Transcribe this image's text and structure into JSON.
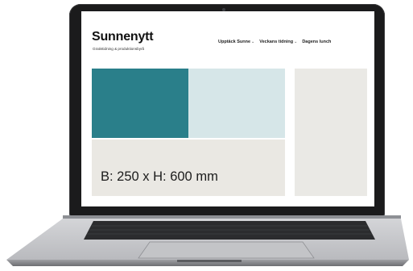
{
  "site": {
    "logo": "Sunnenytt",
    "tagline": "Gratistidning & produktionsbyrå",
    "nav": [
      {
        "label": "Upptäck Sunne",
        "dropdown": true
      },
      {
        "label": "Veckans tidning",
        "dropdown": true
      },
      {
        "label": "Dagens lunch",
        "dropdown": false
      }
    ],
    "banner_text": "B: 250 x H: 600 mm"
  },
  "icons": {
    "chevron": "chevron-down-icon"
  },
  "colors": {
    "teal": "#2a7f8a",
    "light_teal": "#d6e6e8",
    "ad_gray": "#eae9e5",
    "laptop_bezel": "#1b1b1c",
    "laptop_body": "#c8c9cc"
  }
}
